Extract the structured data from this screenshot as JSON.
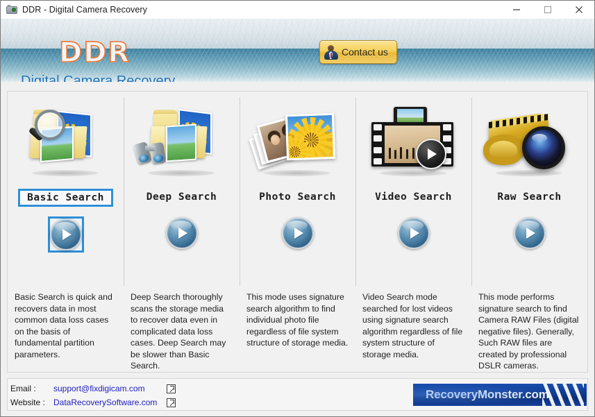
{
  "window": {
    "title": "DDR - Digital Camera Recovery",
    "icon": "camera-icon",
    "minimize_label": "Minimize",
    "maximize_label": "Maximize",
    "close_label": "Close"
  },
  "header": {
    "logo_text": "DDR",
    "tagline": "Digital Camera Recovery",
    "contact_button": "Contact us",
    "logo_color": "#f2712b",
    "tagline_color": "#1b6fb5",
    "contact_button_color": "#f5d15c"
  },
  "modes": [
    {
      "id": "basic-search",
      "label": "Basic Search",
      "icon": "folder-magnifier-icon",
      "selected": true,
      "description": "Basic Search is quick and recovers data in most common data loss cases on the basis of fundamental partition parameters."
    },
    {
      "id": "deep-search",
      "label": "Deep Search",
      "icon": "folder-binoculars-icon",
      "selected": false,
      "description": "Deep Search thoroughly scans the storage media to recover data even in complicated data loss cases. Deep Search may be slower than Basic Search."
    },
    {
      "id": "photo-search",
      "label": "Photo Search",
      "icon": "photo-stack-icon",
      "selected": false,
      "description": "This mode uses signature search algorithm to find individual photo file regardless of file system structure of storage media."
    },
    {
      "id": "video-search",
      "label": "Video Search",
      "icon": "film-strip-play-icon",
      "selected": false,
      "description": "Video Search mode searched for lost videos using signature search algorithm regardless of file system structure of storage media."
    },
    {
      "id": "raw-search",
      "label": "Raw Search",
      "icon": "film-roll-lens-icon",
      "selected": false,
      "description": "This mode performs signature search to find Camera RAW Files (digital negative files). Generally, Such RAW files are created by professional DSLR cameras."
    }
  ],
  "footer": {
    "email_label": "Email :",
    "email_value": "support@fixdigicam.com",
    "website_label": "Website :",
    "website_value": "DataRecoverySoftware.com",
    "external_link_icon": "external-link-icon",
    "brand_text": "RecoveryMonster.com",
    "brand_color": "#0f3d96",
    "link_color": "#2020c0"
  },
  "selection_color": "#2f8fd6"
}
